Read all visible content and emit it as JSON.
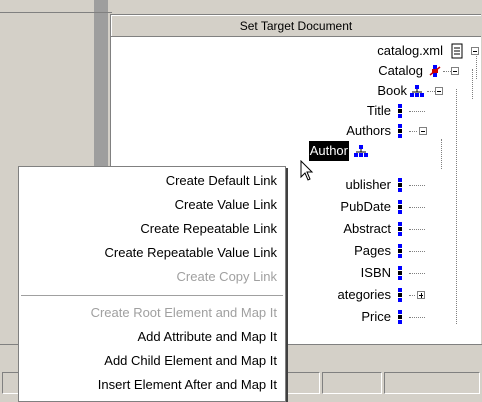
{
  "panel": {
    "title": "Set Target Document"
  },
  "tree": {
    "nodes": [
      {
        "label": "catalog.xml",
        "icon": "document-icon"
      },
      {
        "label": "Catalog",
        "icon": "element-red-icon"
      },
      {
        "label": "Book",
        "icon": "element-tree-icon"
      },
      {
        "label": "Title",
        "icon": "element-icon"
      },
      {
        "label": "Authors",
        "icon": "element-icon"
      },
      {
        "label": "Author",
        "icon": "element-tree-icon"
      },
      {
        "label": "ublisher",
        "icon": "element-icon"
      },
      {
        "label": "PubDate",
        "icon": "element-icon"
      },
      {
        "label": "Abstract",
        "icon": "element-icon"
      },
      {
        "label": "Pages",
        "icon": "element-icon"
      },
      {
        "label": "ISBN",
        "icon": "element-icon"
      },
      {
        "label": "ategories",
        "icon": "element-icon"
      },
      {
        "label": "Price",
        "icon": "element-icon"
      }
    ]
  },
  "menu": {
    "items": [
      {
        "label": "Create Default Link",
        "enabled": true
      },
      {
        "label": "Create Value Link",
        "enabled": true
      },
      {
        "label": "Create Repeatable Link",
        "enabled": true
      },
      {
        "label": "Create Repeatable Value Link",
        "enabled": true
      },
      {
        "label": "Create Copy Link",
        "enabled": false
      },
      {
        "label": "Create Root Element and Map It",
        "enabled": false
      },
      {
        "label": "Add Attribute and Map It",
        "enabled": true
      },
      {
        "label": "Add Child Element and Map It",
        "enabled": true
      },
      {
        "label": "Insert Element After and Map It",
        "enabled": true
      }
    ]
  },
  "colors": {
    "chrome": "#d4d0c8",
    "selection": "#000000",
    "element_blue": "#0000ff",
    "element_red": "#cc0000",
    "disabled_text": "#a0a0a0"
  }
}
